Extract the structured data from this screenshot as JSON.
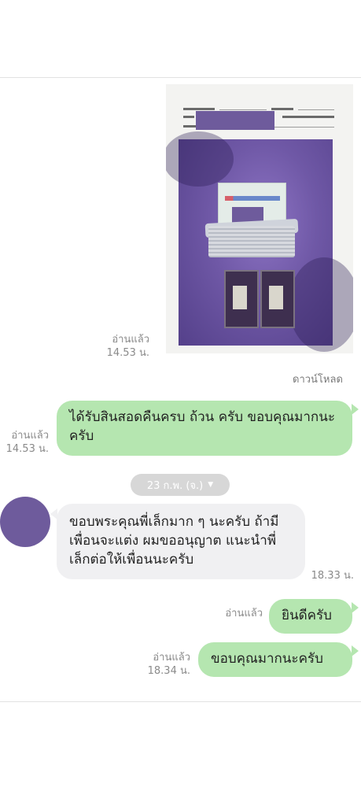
{
  "photo": {
    "read_label": "อ่านแล้ว",
    "time": "14.53 น.",
    "download_label": "ดาวน์โหลด"
  },
  "messages": {
    "m1": {
      "text": "ได้รับสินสอดคืนครบ ถ้วน ครับ ขอบคุณมากนะครับ",
      "read_label": "อ่านแล้ว",
      "time": "14.53 น."
    },
    "date_separator": "23 ก.พ. (จ.)",
    "m2": {
      "text": "ขอบพระคุณพี่เล็กมาก ๆ นะครับ ถ้ามีเพื่อนจะแต่ง ผมขออนุญาต แนะนำพี่เล็กต่อให้เพื่อนนะครับ",
      "time": "18.33 น."
    },
    "m3": {
      "text": "ยินดีครับ",
      "read_label": "อ่านแล้ว"
    },
    "m4": {
      "text": "ขอบคุณมากนะครับ",
      "read_label": "อ่านแล้ว",
      "time": "18.34 น."
    }
  },
  "colors": {
    "outgoing_bubble": "#b5e6b0",
    "incoming_bubble": "#f0f0f2",
    "date_pill": "#d7d7d7",
    "redaction": "#6e5b9c"
  },
  "icons": {
    "date_dropdown": "caret-down-icon"
  }
}
